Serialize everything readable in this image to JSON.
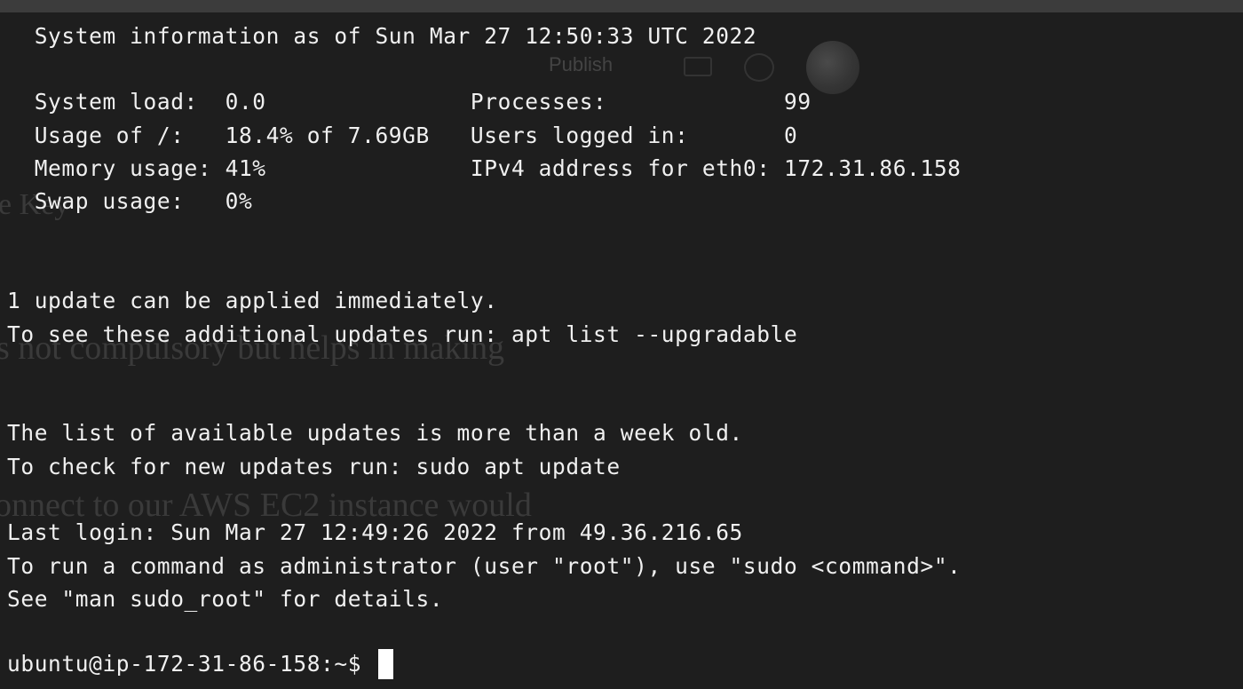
{
  "background_color": "#1e1e1e",
  "text_color": "#f0f0f0",
  "ghost": {
    "publish": "Publish",
    "key_fragment": "e  Key",
    "line1": "s not compulsory but helps in making",
    "line2": "onnect to our AWS EC2 instance would"
  },
  "terminal": {
    "lines": [
      "  System information as of Sun Mar 27 12:50:33 UTC 2022",
      "  System load:  0.0               Processes:             99",
      "  Usage of /:   18.4% of 7.69GB   Users logged in:       0",
      "  Memory usage: 41%               IPv4 address for eth0: 172.31.86.158",
      "  Swap usage:   0%",
      "1 update can be applied immediately.",
      "To see these additional updates run: apt list --upgradable",
      "The list of available updates is more than a week old.",
      "To check for new updates run: sudo apt update",
      "Last login: Sun Mar 27 12:49:26 2022 from 49.36.216.65",
      "To run a command as administrator (user \"root\"), use \"sudo <command>\".",
      "See \"man sudo_root\" for details."
    ],
    "prompt": "ubuntu@ip-172-31-86-158:~$ "
  },
  "icons": {
    "cursor": "block-cursor-icon",
    "avatar": "avatar"
  }
}
